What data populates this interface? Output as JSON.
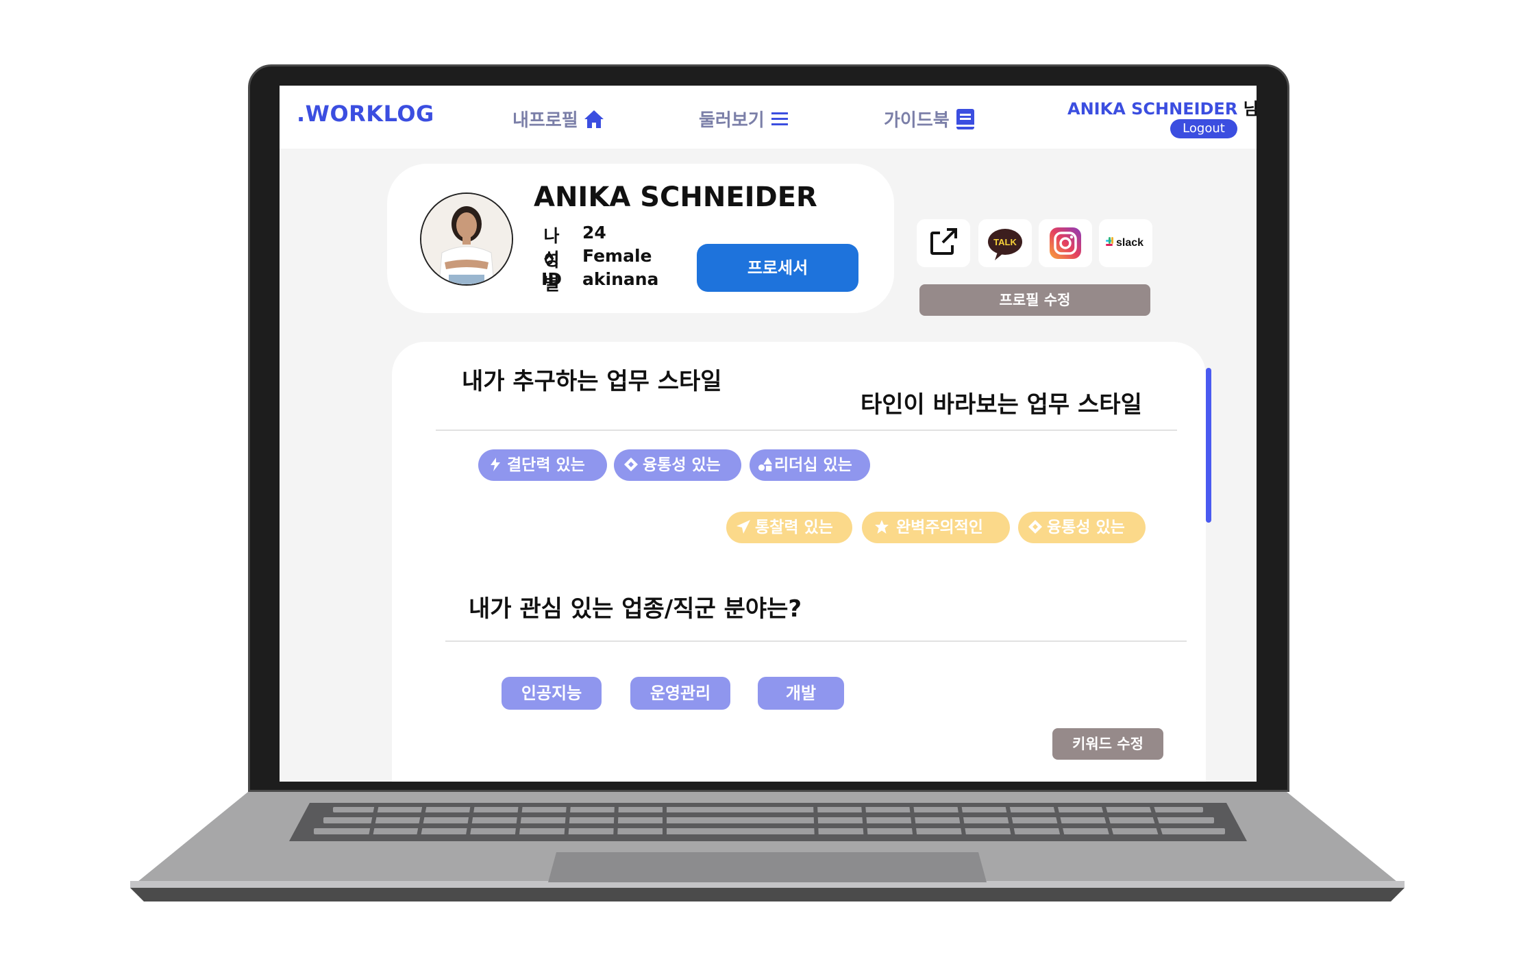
{
  "nav": {
    "brand": ".WORKLOG",
    "my_profile": "내프로필",
    "browse": "둘러보기",
    "guidebook": "가이드북",
    "user_name": "ANIKA SCHNEIDER",
    "user_suffix": "님",
    "logout": "Logout"
  },
  "profile": {
    "name": "ANIKA SCHNEIDER",
    "fields": [
      {
        "label": "나이",
        "value": "24"
      },
      {
        "label": "성별",
        "value": "Female"
      },
      {
        "label": "ID",
        "value": "akinana"
      }
    ],
    "role_button": "프로세서",
    "social_icons": [
      "external-link-icon",
      "kakaotalk-icon",
      "instagram-icon",
      "slack-icon"
    ],
    "kakao_text": "TALK",
    "slack_text": "slack",
    "edit_profile": "프로필 수정"
  },
  "styles": {
    "self_title": "내가 추구하는 업무 스타일",
    "others_title": "타인이 바라보는 업무 스타일",
    "self_tags": [
      {
        "icon": "bolt-icon",
        "label": "결단력 있는"
      },
      {
        "icon": "diamond-icon",
        "label": "융통성 있는"
      },
      {
        "icon": "shapes-icon",
        "label": "리더십 있는"
      }
    ],
    "others_tags": [
      {
        "icon": "send-icon",
        "label": "통찰력 있는"
      },
      {
        "icon": "star-icon",
        "label": "완벽주의적인"
      },
      {
        "icon": "diamond-icon",
        "label": "융통성 있는"
      }
    ]
  },
  "interests": {
    "title": "내가 관심 있는 업종/직군 분야는?",
    "keywords": [
      "인공지능",
      "운영관리",
      "개발"
    ],
    "edit_keywords": "키워드 수정"
  },
  "colors": {
    "brand": "#3b4ee0",
    "role_button": "#1e73dc",
    "self_tag": "#8f96ee",
    "others_tag": "#fbd98a",
    "edit_button": "#968a8a",
    "scrollbar": "#4a5af0"
  }
}
